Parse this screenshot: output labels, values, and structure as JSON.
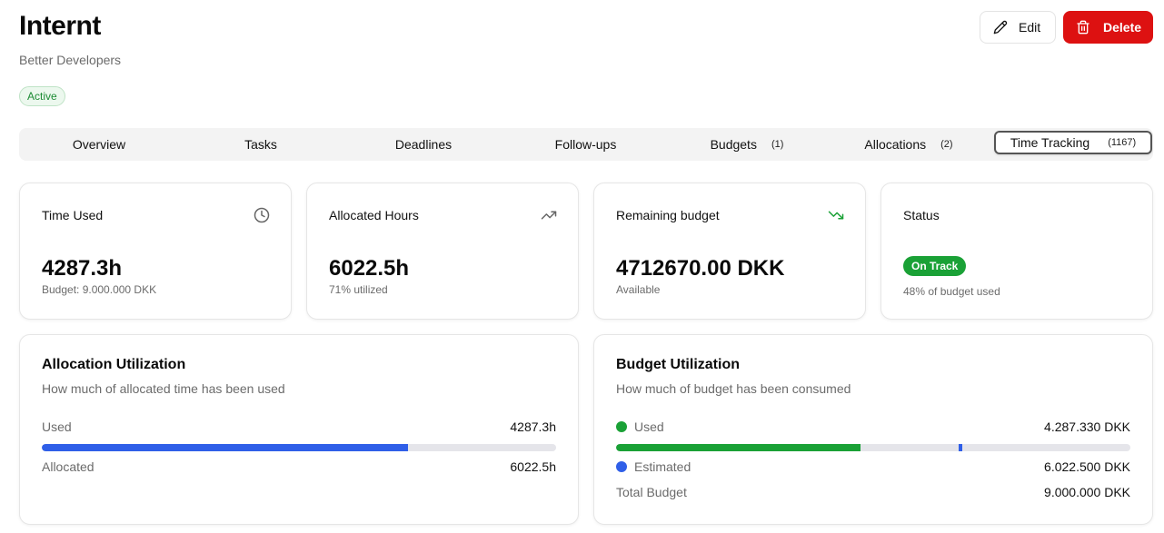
{
  "header": {
    "title": "Internt",
    "subtitle": "Better Developers",
    "status": "Active",
    "edit_label": "Edit",
    "delete_label": "Delete"
  },
  "tabs": [
    {
      "label": "Overview",
      "count": ""
    },
    {
      "label": "Tasks",
      "count": ""
    },
    {
      "label": "Deadlines",
      "count": ""
    },
    {
      "label": "Follow-ups",
      "count": ""
    },
    {
      "label": "Budgets",
      "count": "(1)"
    },
    {
      "label": "Allocations",
      "count": "(2)"
    },
    {
      "label": "Time Tracking",
      "count": "(1167)",
      "active": true
    }
  ],
  "stats": {
    "time_used": {
      "label": "Time Used",
      "value": "4287.3h",
      "note": "Budget: 9.000.000 DKK",
      "icon": "clock-icon"
    },
    "allocated": {
      "label": "Allocated Hours",
      "value": "6022.5h",
      "note": "71% utilized",
      "icon": "trending-up-icon"
    },
    "remaining": {
      "label": "Remaining budget",
      "value": "4712670.00 DKK",
      "note": "Available",
      "icon": "trending-down-icon"
    },
    "status": {
      "label": "Status",
      "badge": "On Track",
      "note": "48% of budget used"
    }
  },
  "allocation_utilization": {
    "title": "Allocation Utilization",
    "description": "How much of allocated time has been used",
    "used_label": "Used",
    "used_value": "4287.3h",
    "allocated_label": "Allocated",
    "allocated_value": "6022.5h",
    "used_fraction": 0.712
  },
  "budget_utilization": {
    "title": "Budget Utilization",
    "description": "How much of budget has been consumed",
    "used_label": "Used",
    "used_value": "4.287.330 DKK",
    "estimated_label": "Estimated",
    "estimated_value": "6.022.500 DKK",
    "total_label": "Total Budget",
    "total_value": "9.000.000 DKK",
    "used_fraction": 0.476,
    "estimated_fraction": 0.669
  },
  "colors": {
    "accent_red": "#dd1111",
    "used_green": "#1aa136",
    "estimated_blue": "#2f5fe8",
    "active_green": "#1c8b34"
  }
}
